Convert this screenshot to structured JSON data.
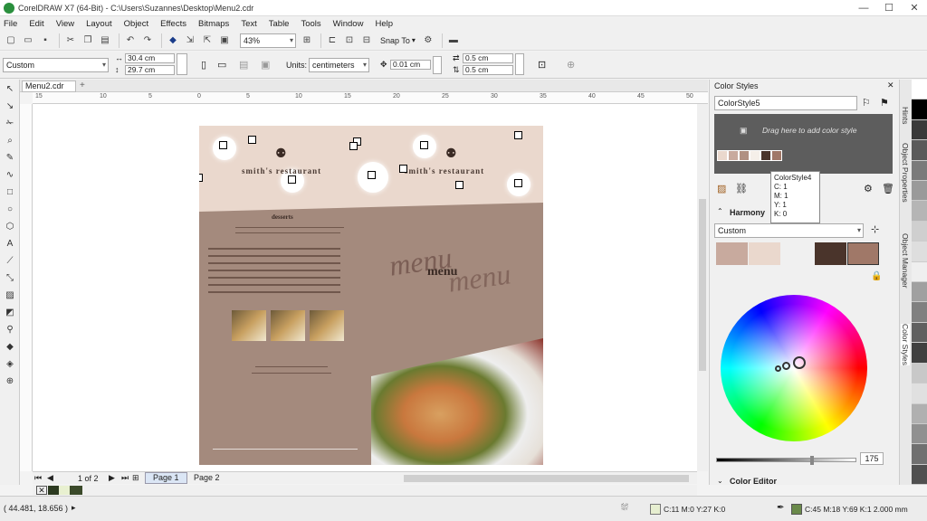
{
  "window": {
    "title": "CorelDRAW X7 (64-Bit) - C:\\Users\\Suzannes\\Desktop\\Menu2.cdr",
    "controls": [
      "—",
      "☐",
      "✕"
    ]
  },
  "menu": [
    "File",
    "Edit",
    "View",
    "Layout",
    "Object",
    "Effects",
    "Bitmaps",
    "Text",
    "Table",
    "Tools",
    "Window",
    "Help"
  ],
  "toolbar": {
    "zoom": "43%",
    "snap_label": "Snap To"
  },
  "propbar": {
    "page_preset": "Custom",
    "width": "30.4 cm",
    "height": "29.7 cm",
    "units_label": "Units:",
    "units": "centimeters",
    "nudge": "0.01 cm",
    "dup_x": "0.5 cm",
    "dup_y": "0.5 cm"
  },
  "document_tab": "Menu2.cdr",
  "ruler_h_labels": [
    "15",
    "10",
    "5",
    "0",
    "5",
    "10",
    "15",
    "20",
    "25",
    "30",
    "35",
    "40",
    "45",
    "50"
  ],
  "page": {
    "restaurant_name_1": "smith's restaurant",
    "restaurant_name_2": "smith's restaurant",
    "menu_script": "menu",
    "menu_script_2": "menu",
    "menu_title": "menu",
    "desserts_heading": "desserts"
  },
  "page_nav": {
    "count": "1 of 2",
    "tab1": "Page 1",
    "tab2": "Page 2"
  },
  "panel": {
    "title": "Color Styles",
    "style_name": "ColorStyle5",
    "drop_hint": "Drag here to add color style",
    "tooltip": {
      "name": "ColorStyle4",
      "c": "C: 1",
      "m": "M: 1",
      "y": "Y: 1",
      "k": "K: 0"
    },
    "harmony_label": "Harmony",
    "harmony_preset": "Custom",
    "brightness_value": "175",
    "color_editor": "Color Editor"
  },
  "dock_tabs": [
    "Hints",
    "Object Properties",
    "Object Manager",
    "Color Styles"
  ],
  "swatches": [
    "#c8aa9e",
    "#ead8cd",
    "#4a342b",
    "#a07868"
  ],
  "palette": [
    "#ffffff",
    "#000000",
    "#3a3a3a",
    "#5a5a5a",
    "#7a7a7a",
    "#9a9a9a",
    "#b5b5b5",
    "#cfcfcf",
    "#dedede",
    "#efefef",
    "#a0a0a0",
    "#808080",
    "#606060",
    "#404040",
    "#c8c8c8",
    "#e0e0e0",
    "#b0b0b0",
    "#909090",
    "#707070",
    "#505050"
  ],
  "status": {
    "coords": "( 44.481, 18.656 )",
    "fill_readout": "C:11 M:0 Y:27 K:0",
    "outline_readout": "C:45 M:18 Y:69 K:1  2.000 mm"
  }
}
